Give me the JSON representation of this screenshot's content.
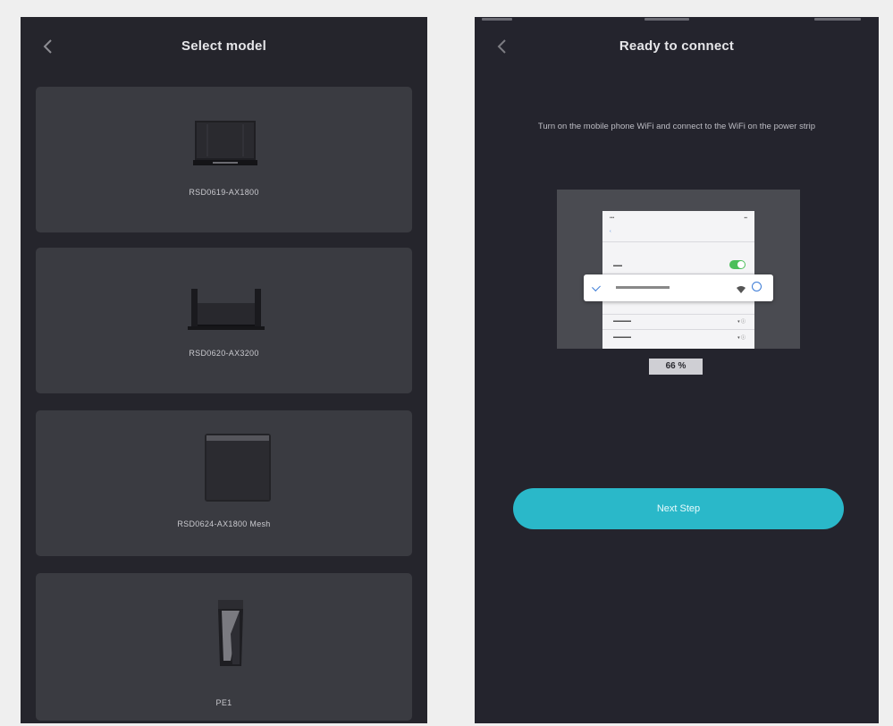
{
  "left_screen": {
    "title": "Select model",
    "models": [
      {
        "label": "RSD0619-AX1800",
        "icon": "router-flat-icon"
      },
      {
        "label": "RSD0620-AX3200",
        "icon": "router-antenna-icon"
      },
      {
        "label": "RSD0624-AX1800 Mesh",
        "icon": "mesh-node-icon"
      },
      {
        "label": "PE1",
        "icon": "tower-device-icon"
      }
    ]
  },
  "right_screen": {
    "title": "Ready to connect",
    "instruction": "Turn on the mobile phone WiFi and connect to the WiFi on the power strip",
    "progress_label": "66 %",
    "progress_value": 66,
    "next_button_label": "Next Step"
  },
  "colors": {
    "page_background": "#efefef",
    "screen_background": "#25252c",
    "card_background": "#3a3b41",
    "accent": "#2ab8c9"
  }
}
